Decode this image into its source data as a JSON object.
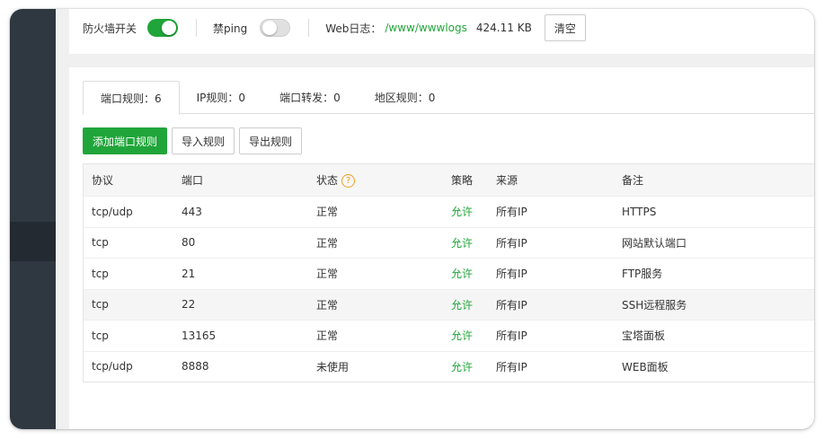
{
  "top": {
    "firewall_label": "防火墙开关",
    "firewall_on": true,
    "ping_label": "禁ping",
    "ping_on": false,
    "weblog_label": "Web日志：",
    "weblog_path": "/www/wwwlogs",
    "weblog_size": "424.11 KB",
    "clear_label": "清空"
  },
  "tabs": [
    {
      "label": "端口规则：6",
      "active": true
    },
    {
      "label": "IP规则：0",
      "active": false
    },
    {
      "label": "端口转发：0",
      "active": false
    },
    {
      "label": "地区规则：0",
      "active": false
    }
  ],
  "actions": {
    "add_label": "添加端口规则",
    "import_label": "导入规则",
    "export_label": "导出规则"
  },
  "table": {
    "headers": [
      "协议",
      "端口",
      "状态",
      "策略",
      "来源",
      "备注"
    ],
    "status_help_icon": "question-circle-icon",
    "rows": [
      {
        "protocol": "tcp/udp",
        "port": "443",
        "status": "正常",
        "policy": "允许",
        "source": "所有IP",
        "note": "HTTPS"
      },
      {
        "protocol": "tcp",
        "port": "80",
        "status": "正常",
        "policy": "允许",
        "source": "所有IP",
        "note": "网站默认端口"
      },
      {
        "protocol": "tcp",
        "port": "21",
        "status": "正常",
        "policy": "允许",
        "source": "所有IP",
        "note": "FTP服务"
      },
      {
        "protocol": "tcp",
        "port": "22",
        "status": "正常",
        "policy": "允许",
        "source": "所有IP",
        "note": "SSH远程服务"
      },
      {
        "protocol": "tcp",
        "port": "13165",
        "status": "正常",
        "policy": "允许",
        "source": "所有IP",
        "note": "宝塔面板"
      },
      {
        "protocol": "tcp/udp",
        "port": "8888",
        "status": "未使用",
        "policy": "允许",
        "source": "所有IP",
        "note": "WEB面板"
      }
    ]
  },
  "colors": {
    "accent": "#20a53a",
    "sidebar": "#2f3740",
    "help_icon": "#f0a020"
  }
}
